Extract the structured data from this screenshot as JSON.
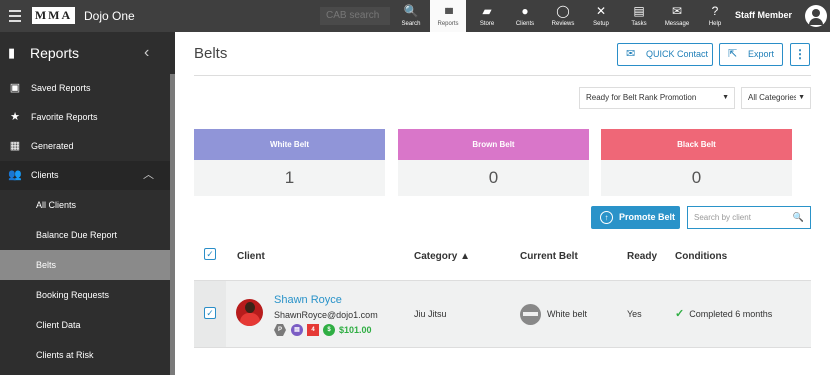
{
  "topbar": {
    "logo": "MMA",
    "app_name": "Dojo One",
    "search_placeholder": "CAB search",
    "nav": [
      {
        "label": "Search",
        "icon": "search-icon",
        "glyph": "🔍"
      },
      {
        "label": "Reports",
        "icon": "bar-chart-icon",
        "glyph": "▮▮▮"
      },
      {
        "label": "Store",
        "icon": "store-icon",
        "glyph": "▰"
      },
      {
        "label": "Clients",
        "icon": "user-icon",
        "glyph": "●"
      },
      {
        "label": "Reviews",
        "icon": "chat-icon",
        "glyph": "◯"
      },
      {
        "label": "Setup",
        "icon": "tools-icon",
        "glyph": "✕"
      },
      {
        "label": "Tasks",
        "icon": "clipboard-icon",
        "glyph": "▤"
      },
      {
        "label": "Message",
        "icon": "message-icon",
        "glyph": "✉"
      },
      {
        "label": "Help",
        "icon": "help-icon",
        "glyph": "?"
      }
    ],
    "staff_label": "Staff Member"
  },
  "sidebar": {
    "title": "Reports",
    "items": [
      {
        "label": "Saved Reports",
        "glyph": "▣"
      },
      {
        "label": "Favorite Reports",
        "glyph": "★"
      },
      {
        "label": "Generated",
        "glyph": "▦"
      },
      {
        "label": "Clients",
        "glyph": "👥"
      }
    ],
    "subitems": [
      "All Clients",
      "Balance Due Report",
      "Belts",
      "Booking Requests",
      "Client Data",
      "Clients at Risk"
    ]
  },
  "main": {
    "title": "Belts",
    "quick_contact": "QUICK Contact",
    "export": "Export",
    "more": "⋮",
    "filter_rank": "Ready for Belt Rank Promotion",
    "filter_category": "All Categories",
    "cards": [
      {
        "label": "White Belt",
        "value": "1",
        "color": "#9095d8"
      },
      {
        "label": "Brown Belt",
        "value": "0",
        "color": "#d976c9"
      },
      {
        "label": "Black Belt",
        "value": "0",
        "color": "#ef6777"
      }
    ],
    "promote_label": "Promote Belt",
    "search_placeholder": "Search by client",
    "columns": {
      "client": "Client",
      "category": "Category ▲",
      "current_belt": "Current Belt",
      "ready": "Ready",
      "conditions": "Conditions"
    },
    "rows": [
      {
        "name": "Shawn Royce",
        "email": "ShawnRoyce@dojo1.com",
        "badges": [
          "P",
          "▤",
          "4",
          "$"
        ],
        "amount": "$101.00",
        "category": "Jiu Jitsu",
        "belt": "White belt",
        "ready": "Yes",
        "condition": "Completed 6 months"
      }
    ]
  }
}
